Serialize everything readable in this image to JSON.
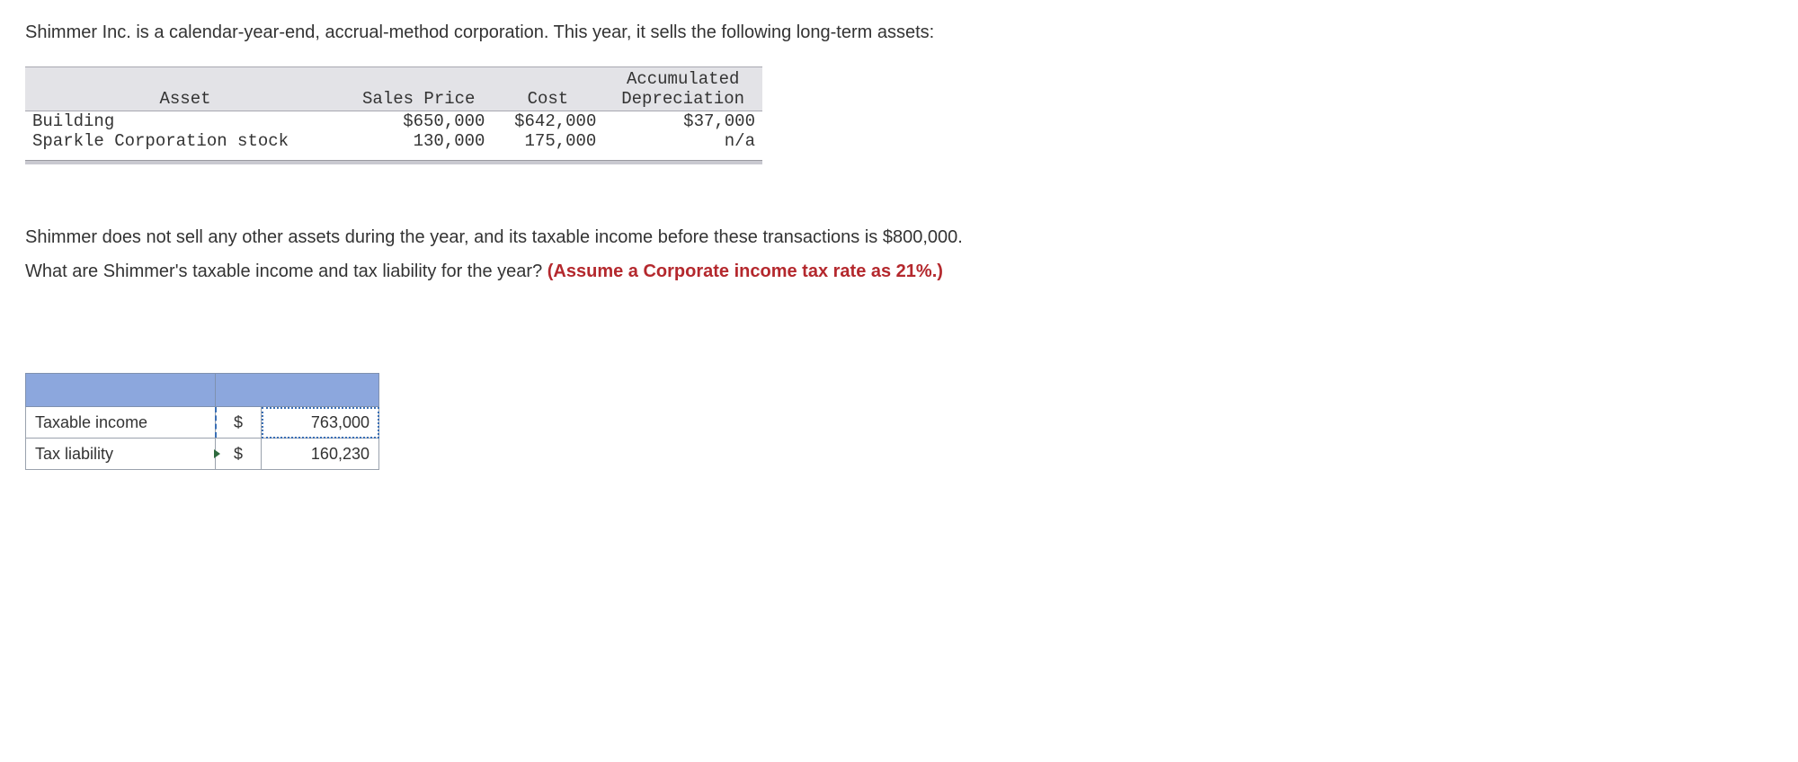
{
  "intro": "Shimmer Inc. is a calendar-year-end, accrual-method corporation. This year, it sells the following long-term assets:",
  "asset_table": {
    "headers": {
      "asset": "Asset",
      "sales_price": "Sales Price",
      "cost": "Cost",
      "accum_dep": "Accumulated\nDepreciation"
    },
    "rows": [
      {
        "asset": "Building",
        "sales_price": "$650,000",
        "cost": "$642,000",
        "accum_dep": "$37,000"
      },
      {
        "asset": "Sparkle Corporation stock",
        "sales_price": "130,000",
        "cost": "175,000",
        "accum_dep": "n/a"
      }
    ]
  },
  "middle": {
    "line1": "Shimmer does not sell any other assets during the year, and its taxable income before these transactions is $800,000.",
    "line2_a": "What are Shimmer's taxable income and tax liability for the year? ",
    "line2_b": "(Assume a Corporate income tax rate as 21%.)"
  },
  "answer": {
    "rows": [
      {
        "label": "Taxable income",
        "currency": "$",
        "value": "763,000"
      },
      {
        "label": "Tax liability",
        "currency": "$",
        "value": "160,230"
      }
    ]
  }
}
